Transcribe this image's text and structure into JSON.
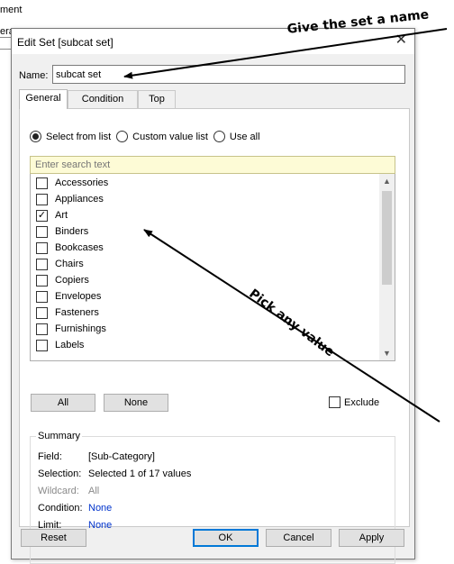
{
  "background": {
    "line1": "ment",
    "line2": "era"
  },
  "dialog": {
    "title": "Edit Set [subcat set]",
    "name_label": "Name:",
    "name_value": "subcat set",
    "tabs": [
      {
        "label": "General",
        "active": true
      },
      {
        "label": "Condition",
        "active": false
      },
      {
        "label": "Top",
        "active": false
      }
    ],
    "radios": [
      {
        "label": "Select from list",
        "checked": true
      },
      {
        "label": "Custom value list",
        "checked": false
      },
      {
        "label": "Use all",
        "checked": false
      }
    ],
    "search_placeholder": "Enter search text",
    "items": [
      {
        "label": "Accessories",
        "checked": false
      },
      {
        "label": "Appliances",
        "checked": false
      },
      {
        "label": "Art",
        "checked": true
      },
      {
        "label": "Binders",
        "checked": false
      },
      {
        "label": "Bookcases",
        "checked": false
      },
      {
        "label": "Chairs",
        "checked": false
      },
      {
        "label": "Copiers",
        "checked": false
      },
      {
        "label": "Envelopes",
        "checked": false
      },
      {
        "label": "Fasteners",
        "checked": false
      },
      {
        "label": "Furnishings",
        "checked": false
      },
      {
        "label": "Labels",
        "checked": false
      }
    ],
    "all_label": "All",
    "none_label": "None",
    "exclude_label": "Exclude",
    "summary": {
      "title": "Summary",
      "field_label": "Field:",
      "field_value": "[Sub-Category]",
      "selection_label": "Selection:",
      "selection_value": "Selected 1 of 17 values",
      "wildcard_label": "Wildcard:",
      "wildcard_value": "All",
      "condition_label": "Condition:",
      "condition_value": "None",
      "limit_label": "Limit:",
      "limit_value": "None"
    },
    "buttons": {
      "reset": "Reset",
      "ok": "OK",
      "cancel": "Cancel",
      "apply": "Apply"
    }
  },
  "annotations": {
    "name_hint": "Give the set a name",
    "value_hint": "Pick any value"
  },
  "colors": {
    "search_bg": "#fdfbd6",
    "link": "#0033cc",
    "primary_border": "#0078d7"
  }
}
